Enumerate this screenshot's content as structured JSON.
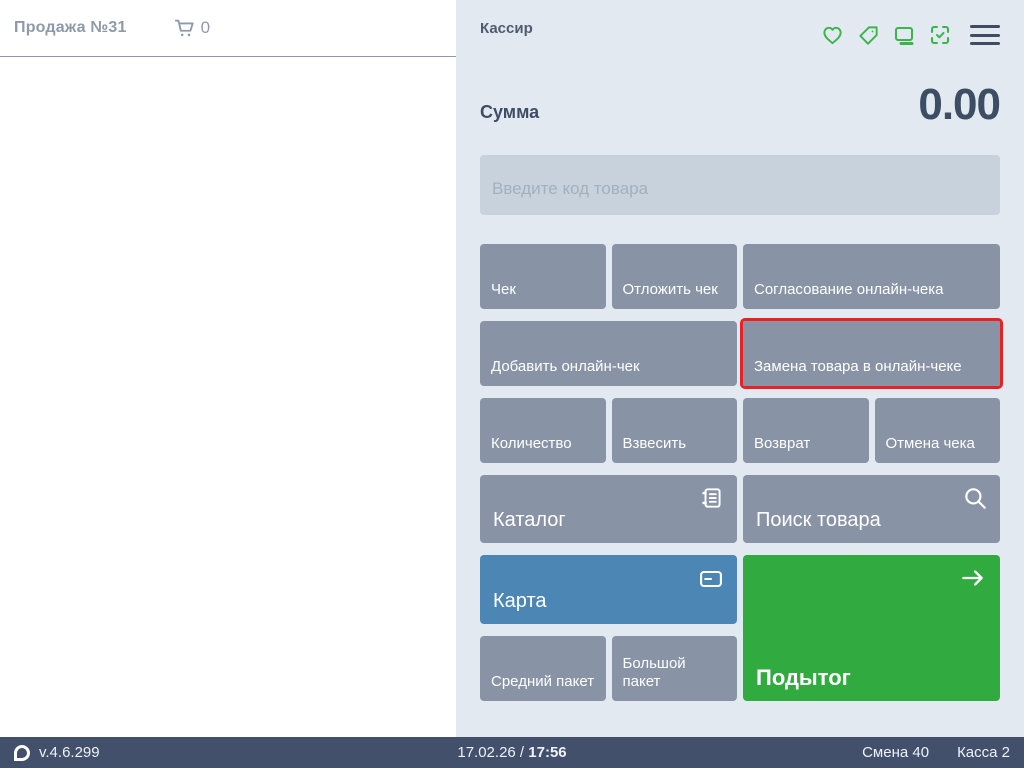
{
  "left_panel": {
    "title": "Продажа №31",
    "cart_count": "0"
  },
  "header": {
    "user": "Кассир",
    "icons": [
      "heart-icon",
      "tag-icon",
      "display-icon",
      "scan-check-icon",
      "menu-icon"
    ]
  },
  "sum": {
    "label": "Сумма",
    "value": "0.00"
  },
  "input": {
    "placeholder": "Введите код товара",
    "value": ""
  },
  "buttons": {
    "receipt": "Чек",
    "defer_receipt": "Отложить чек",
    "approve_online_receipt": "Согласование онлайн-чека",
    "add_online_receipt": "Добавить онлайн-чек",
    "replace_item_online_receipt": "Замена товара в онлайн-чеке",
    "quantity": "Количество",
    "weigh": "Взвесить",
    "refund": "Возврат",
    "cancel_receipt": "Отмена чека",
    "catalog": "Каталог",
    "search_product": "Поиск товара",
    "card": "Карта",
    "subtotal": "Подытог",
    "medium_bag": "Средний пакет",
    "large_bag": "Большой пакет"
  },
  "footer": {
    "version": "v.4.6.299",
    "date": "17.02.26",
    "separator": "/",
    "time": "17:56",
    "shift": "Смена 40",
    "register": "Касса 2"
  },
  "colors": {
    "accent_green_icons": "#3bb54a",
    "button_gray": "#8894a6",
    "button_blue": "#4c86b5",
    "button_green": "#31ab40",
    "highlight_red": "#e82127",
    "panel_bg": "#e3e9f0",
    "footer_bg": "#42506b",
    "dark_text": "#3d4e64"
  }
}
